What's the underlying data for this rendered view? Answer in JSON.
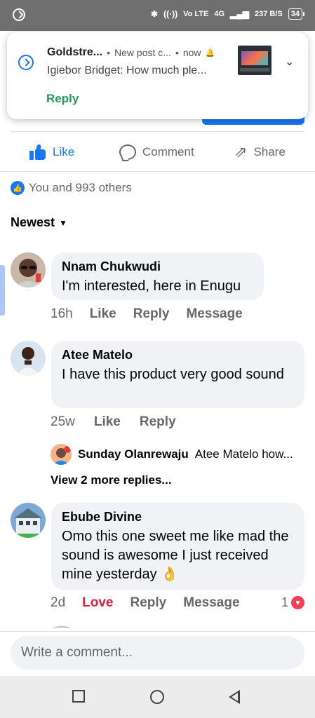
{
  "status_bar": {
    "icons": [
      "bluetooth-icon",
      "hotspot-icon",
      "volte-icon",
      "signal-icon",
      "signal-icon"
    ],
    "network": "4G",
    "vo_lte": "Vo LTE",
    "speed": "237 B/S",
    "battery": "34"
  },
  "notification": {
    "app": "Goldstre...",
    "title": "New post c...",
    "time": "now",
    "body": "Igiebor Bridget: How much ple...",
    "reply_label": "Reply"
  },
  "actions": {
    "like": "Like",
    "comment": "Comment",
    "share": "Share"
  },
  "reactions_text": "You and 993 others",
  "sort_label": "Newest",
  "comments": [
    {
      "author": "Nnam Chukwudi",
      "text": "I'm interested, here in Enugu",
      "time": "16h",
      "like": "Like",
      "reply": "Reply",
      "message": "Message"
    },
    {
      "author": "Atee Matelo",
      "text": "I have this product very good sound",
      "time": "25w",
      "like": "Like",
      "reply": "Reply"
    },
    {
      "author": "Ebube Divine",
      "text": "Omo this one sweet me like mad the sound is awesome I just received mine yesterday 👌",
      "time": "2d",
      "love": "Love",
      "reply": "Reply",
      "message": "Message",
      "love_count": "1"
    }
  ],
  "reply_preview": {
    "name": "Sunday Olanrewaju",
    "text": "Atee Matelo how..."
  },
  "more_replies": "View 2 more replies...",
  "composer_placeholder": "Write a comment...",
  "colors": {
    "brand": "#1877f2",
    "love": "#e41e3f",
    "reply_green": "#1f9d55"
  }
}
